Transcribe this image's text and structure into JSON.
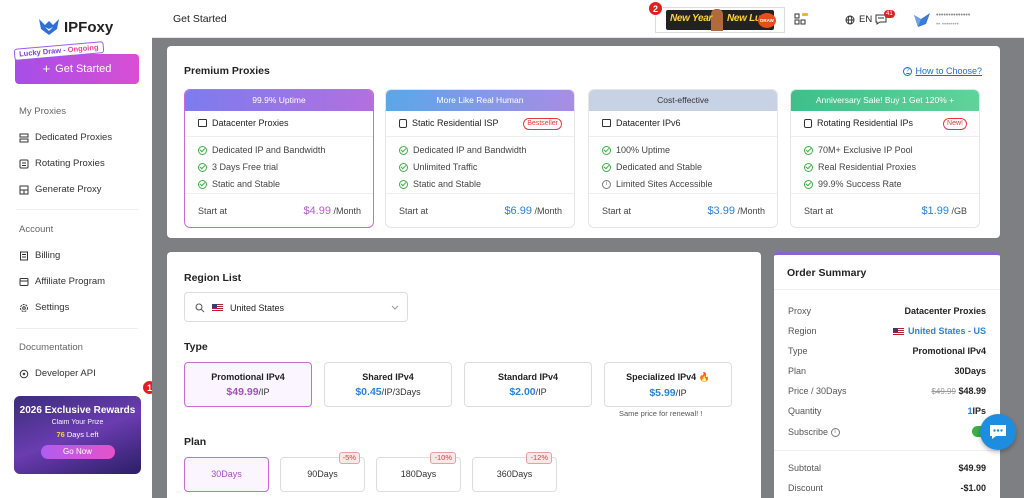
{
  "brand": {
    "name": "IPFoxy"
  },
  "sidebar": {
    "lucky_tag": "Lucky Draw -",
    "lucky_status": "Ongoing",
    "get_started": "Get Started",
    "sections": [
      "My Proxies",
      "Account",
      "Documentation"
    ],
    "items": [
      {
        "label": "Dedicated Proxies",
        "icon": "server-icon"
      },
      {
        "label": "Rotating Proxies",
        "icon": "rotate-icon"
      },
      {
        "label": "Generate Proxy",
        "icon": "grid-icon"
      },
      {
        "label": "Billing",
        "icon": "billing-icon"
      },
      {
        "label": "Affiliate Program",
        "icon": "affiliate-icon"
      },
      {
        "label": "Settings",
        "icon": "gear-icon"
      },
      {
        "label": "Developer API",
        "icon": "api-icon"
      }
    ],
    "reward": {
      "title": "2026 Exclusive Rewards",
      "sub": "Claim Your Prize",
      "days_num": "76",
      "days_text": "Days Left",
      "button": "Go Now",
      "badge": "1"
    }
  },
  "topbar": {
    "title": "Get Started",
    "banner": {
      "text_a": "New Year",
      "text_b": "New Luck",
      "draw": "DRAW",
      "badge": "2"
    },
    "language": "EN",
    "notif_count": "41",
    "user_name": "••••••••••••••",
    "user_sub": "•• ••••••••"
  },
  "premium": {
    "title": "Premium Proxies",
    "how_to": "How to Choose?",
    "cards": [
      {
        "header": "99.9% Uptime",
        "name": "Datacenter Proxies",
        "tag": "",
        "features": [
          "Dedicated IP and Bandwidth",
          "3 Days Free trial",
          "Static and Stable"
        ],
        "start": "Start at",
        "price": "$4.99",
        "unit": "/Month"
      },
      {
        "header": "More Like Real Human",
        "name": "Static Residential ISP",
        "tag": "Bestseller",
        "features": [
          "Dedicated IP and Bandwidth",
          "Unlimited Traffic",
          "Static and Stable"
        ],
        "start": "Start at",
        "price": "$6.99",
        "unit": "/Month"
      },
      {
        "header": "Cost-effective",
        "name": "Datacenter IPv6",
        "tag": "",
        "features": [
          "100% Uptime",
          "Dedicated and Stable",
          "Limited Sites Accessible"
        ],
        "start": "Start at",
        "price": "$3.99",
        "unit": "/Month"
      },
      {
        "header": "Anniversary Sale! Buy 1 Get 120% +",
        "name": "Rotating Residential IPs",
        "tag": "New!",
        "features": [
          "70M+ Exclusive IP Pool",
          "Real Residential Proxies",
          "99.9% Success Rate"
        ],
        "start": "Start at",
        "price": "$1.99",
        "unit": "/GB"
      }
    ],
    "header_colors": [
      "#9b6fe8",
      "#8d82e0",
      "#c9d5e6",
      "#4cc58a"
    ]
  },
  "region": {
    "title": "Region List",
    "selected": "United States"
  },
  "type": {
    "title": "Type",
    "options": [
      {
        "name": "Promotional IPv4",
        "price": "$49.99",
        "unit": "/IP"
      },
      {
        "name": "Shared IPv4",
        "price": "$0.45",
        "unit": "/IP/3Days"
      },
      {
        "name": "Standard IPv4",
        "price": "$2.00",
        "unit": "/IP"
      },
      {
        "name": "Specialized IPv4 🔥",
        "price": "$5.99",
        "unit": "/IP"
      }
    ],
    "renewal_note": "Same price for renewal!  !"
  },
  "plan": {
    "title": "Plan",
    "options": [
      {
        "label": "30Days",
        "discount": ""
      },
      {
        "label": "90Days",
        "discount": "-5%"
      },
      {
        "label": "180Days",
        "discount": "-10%"
      },
      {
        "label": "360Days",
        "discount": "-12%"
      }
    ]
  },
  "order": {
    "title": "Order Summary",
    "rows": [
      {
        "k": "Proxy",
        "v": "Datacenter Proxies"
      },
      {
        "k": "Region",
        "v": "United States - US"
      },
      {
        "k": "Type",
        "v": "Promotional IPv4"
      },
      {
        "k": "Plan",
        "v": "30Days"
      },
      {
        "k": "Price / 30Days",
        "old": "$49.99",
        "v": "$48.99"
      },
      {
        "k": "Quantity",
        "num": "1",
        "v": "IPs"
      },
      {
        "k": "Subscribe",
        "v": ""
      },
      {
        "k": "Subtotal",
        "v": "$49.99"
      },
      {
        "k": "Discount",
        "v": "-$1.00"
      }
    ]
  }
}
